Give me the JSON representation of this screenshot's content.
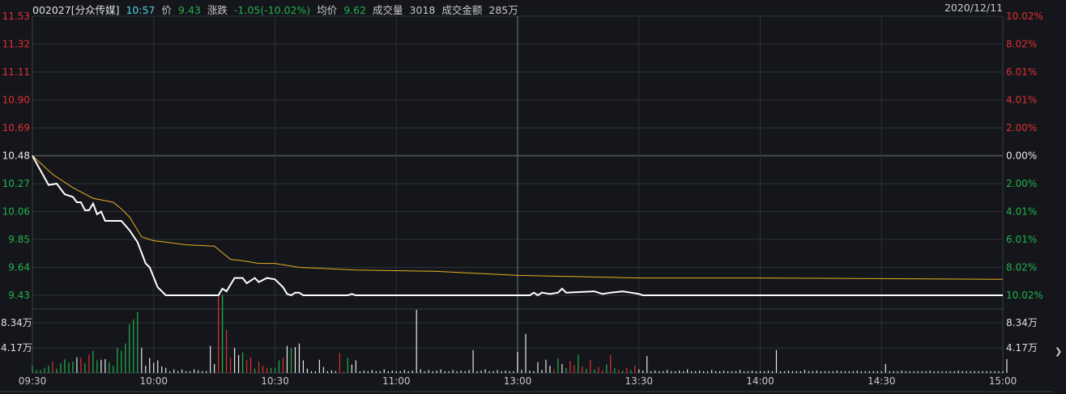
{
  "header": {
    "code_name": "002027[分众传媒]",
    "time": "10:57",
    "price_label": "价",
    "price": "9.43",
    "change_label": "涨跌",
    "change": "-1.05(-10.02%)",
    "avg_label": "均价",
    "avg": "9.62",
    "volume_label": "成交量",
    "volume": "3018",
    "amount_label": "成交金额",
    "amount": "285万",
    "date": "2020/12/11"
  },
  "price_axis": {
    "left": [
      "11.53",
      "11.32",
      "11.11",
      "10.90",
      "10.69",
      "10.48",
      "10.27",
      "10.06",
      "9.85",
      "9.64",
      "9.43"
    ],
    "right": [
      "10.02%",
      "8.02%",
      "6.01%",
      "4.01%",
      "2.00%",
      "0.00%",
      "2.00%",
      "4.01%",
      "6.01%",
      "8.02%",
      "10.02%"
    ],
    "min": 9.43,
    "max": 11.53,
    "prev_close": 10.48
  },
  "volume_axis": {
    "labels": [
      "8.34万",
      "4.17万"
    ],
    "values": [
      8.34,
      4.17
    ]
  },
  "time_axis": [
    "09:30",
    "10:00",
    "10:30",
    "11:00",
    "13:00",
    "13:30",
    "14:00",
    "14:30",
    "15:00"
  ],
  "colors": {
    "up": "#e03030",
    "down": "#22b34a",
    "flat": "#e8e8e8",
    "price_line": "#ffffff",
    "avg_line": "#e8b020",
    "grid": "#2e3138"
  },
  "chart_data": {
    "type": "line",
    "total_minutes": 240,
    "price": [
      [
        0,
        10.48
      ],
      [
        2,
        10.37
      ],
      [
        4,
        10.26
      ],
      [
        6,
        10.27
      ],
      [
        8,
        10.19
      ],
      [
        10,
        10.17
      ],
      [
        11,
        10.13
      ],
      [
        12,
        10.13
      ],
      [
        13,
        10.07
      ],
      [
        14,
        10.07
      ],
      [
        15,
        10.12
      ],
      [
        16,
        10.04
      ],
      [
        17,
        10.06
      ],
      [
        18,
        9.99
      ],
      [
        22,
        9.99
      ],
      [
        24,
        9.92
      ],
      [
        26,
        9.83
      ],
      [
        28,
        9.67
      ],
      [
        29,
        9.64
      ],
      [
        31,
        9.49
      ],
      [
        33,
        9.43
      ],
      [
        46,
        9.43
      ],
      [
        47,
        9.48
      ],
      [
        48,
        9.46
      ],
      [
        50,
        9.56
      ],
      [
        52,
        9.56
      ],
      [
        53,
        9.52
      ],
      [
        55,
        9.56
      ],
      [
        56,
        9.53
      ],
      [
        58,
        9.56
      ],
      [
        60,
        9.55
      ],
      [
        61,
        9.52
      ],
      [
        62,
        9.49
      ],
      [
        63,
        9.44
      ],
      [
        64,
        9.43
      ],
      [
        65,
        9.45
      ],
      [
        66,
        9.45
      ],
      [
        67,
        9.43
      ],
      [
        78,
        9.43
      ],
      [
        79,
        9.44
      ],
      [
        80,
        9.43
      ],
      [
        123,
        9.43
      ],
      [
        124,
        9.45
      ],
      [
        125,
        9.43
      ],
      [
        126,
        9.45
      ],
      [
        128,
        9.44
      ],
      [
        130,
        9.45
      ],
      [
        131,
        9.48
      ],
      [
        132,
        9.45
      ],
      [
        139,
        9.46
      ],
      [
        141,
        9.44
      ],
      [
        143,
        9.45
      ],
      [
        146,
        9.46
      ],
      [
        148,
        9.45
      ],
      [
        150,
        9.44
      ],
      [
        151,
        9.43
      ],
      [
        240,
        9.43
      ]
    ],
    "avg": [
      [
        0,
        10.48
      ],
      [
        5,
        10.34
      ],
      [
        10,
        10.24
      ],
      [
        15,
        10.16
      ],
      [
        20,
        10.13
      ],
      [
        22,
        10.08
      ],
      [
        24,
        10.02
      ],
      [
        26,
        9.92
      ],
      [
        27,
        9.87
      ],
      [
        30,
        9.84
      ],
      [
        33,
        9.83
      ],
      [
        38,
        9.81
      ],
      [
        45,
        9.8
      ],
      [
        47,
        9.75
      ],
      [
        49,
        9.7
      ],
      [
        52,
        9.69
      ],
      [
        56,
        9.67
      ],
      [
        60,
        9.67
      ],
      [
        62,
        9.66
      ],
      [
        66,
        9.64
      ],
      [
        80,
        9.62
      ],
      [
        100,
        9.61
      ],
      [
        120,
        9.58
      ],
      [
        150,
        9.56
      ],
      [
        180,
        9.56
      ],
      [
        240,
        9.55
      ]
    ],
    "volume_wan": [
      1.2,
      0.5,
      0.5,
      0.85,
      1.2,
      1.9,
      0.7,
      1.6,
      2.3,
      1.7,
      1.9,
      2.6,
      2.5,
      1.6,
      3.1,
      3.7,
      2.1,
      2.2,
      2.3,
      1.8,
      1.2,
      4.2,
      3.7,
      4.9,
      8.1,
      8.9,
      10.1,
      4.2,
      1.2,
      2.5,
      1.7,
      2.1,
      1.1,
      0.85,
      0.3,
      0.6,
      0.3,
      0.6,
      0.3,
      0.3,
      0.6,
      0.45,
      0.3,
      0.3,
      4.5,
      1.5,
      13,
      13,
      7.2,
      2.5,
      4.2,
      3,
      3.4,
      2.1,
      2.6,
      0.7,
      1.9,
      1.2,
      0.85,
      0.85,
      0.85,
      2.1,
      2.5,
      4.5,
      4.1,
      4.3,
      4.9,
      2.1,
      0.7,
      0.3,
      0.3,
      2.2,
      1,
      0.3,
      0.45,
      0.3,
      3.3,
      0.3,
      2.5,
      1.4,
      2.1,
      0.3,
      0.4,
      0.3,
      0.5,
      0.3,
      0.3,
      0.6,
      0.3,
      0.4,
      0.3,
      0.3,
      0.5,
      0.3,
      0.4,
      10.5,
      0.6,
      0.3,
      0.5,
      0.3,
      0.4,
      0.6,
      0.3,
      0.3,
      0.5,
      0.3,
      0.4,
      0.3,
      0.5,
      3.8,
      0.3,
      0.4,
      0.6,
      0.3,
      0.3,
      0.5,
      0.3,
      0.4,
      0.3,
      0.3,
      3.5,
      0.5,
      6.5,
      0.4,
      0.3,
      1.8,
      0.5,
      2.2,
      1.2,
      0.6,
      2.4,
      1.5,
      0.8,
      2.0,
      1.3,
      3.0,
      1.1,
      0.7,
      2.2,
      0.6,
      1.0,
      0.5,
      1.4,
      3.0,
      0.8,
      0.5,
      0.4,
      0.9,
      0.5,
      1.2,
      0.6,
      0.4,
      2.8,
      0.3,
      0.4,
      0.3,
      0.3,
      0.5,
      0.3,
      0.3,
      0.4,
      0.3,
      0.6,
      0.3,
      0.3,
      0.4,
      0.3,
      0.3,
      0.5,
      0.3,
      0.3,
      0.4,
      0.3,
      0.3,
      0.3,
      0.5,
      0.3,
      0.3,
      0.4,
      0.3,
      0.3,
      0.3,
      0.4,
      0.3,
      3.8,
      0.3,
      0.3,
      0.4,
      0.3,
      0.3,
      0.3,
      0.5,
      0.3,
      0.3,
      0.4,
      0.3,
      0.3,
      0.3,
      0.3,
      0.4,
      0.3,
      0.3,
      0.3,
      0.3,
      0.4,
      0.3,
      0.3,
      0.3,
      0.3,
      0.3,
      0.3,
      1.5,
      0.3,
      0.3,
      0.3,
      0.4,
      0.3,
      0.3,
      0.3,
      0.3,
      0.3,
      0.3,
      0.4,
      0.3,
      0.3,
      0.3,
      0.3,
      0.3,
      0.3,
      0.4,
      0.3,
      0.3,
      0.3,
      0.3,
      0.3,
      0.3,
      0.3,
      0.3,
      0.3,
      0.3,
      0.3,
      2.3
    ],
    "volume_color": "gggggrgggggwrgrggwwggggggggwwwwwwwwwwwwwwwwwwwrgrrwwgrrgrrrgggrwgwwwwwwwwwwwrrgwwwwwwwwwwwwwwwwwwwwwwwwwwwwwwwwwwwwwwwwwwwwwwwwwwrgwgrrgrgrgrrgrgrgrgrwwwwwwwwwwwwwwwwwwwwwwwwwwwwwwwwwwwwwwwwwwwwwwwwwwwwwwwwwwwwwwwwwwwwwwwwwwwwwwwwwwwwwwwwwww"
  },
  "scrollbar": {
    "icon": "chevron-right-icon",
    "glyph": "❯"
  }
}
